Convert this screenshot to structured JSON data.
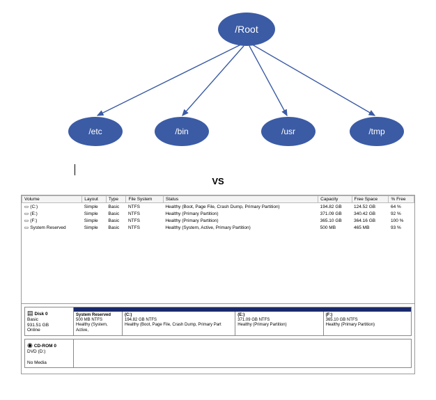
{
  "tree": {
    "root": "/Root",
    "children": [
      "/etc",
      "/bin",
      "/usr",
      "/tmp"
    ]
  },
  "vs_label": "VS",
  "disk_mgmt": {
    "columns": [
      "Volume",
      "Layout",
      "Type",
      "File System",
      "Status",
      "Capacity",
      "Free Space",
      "% Free"
    ],
    "volumes": [
      {
        "icon": "▭",
        "name": "(C:)",
        "layout": "Simple",
        "type": "Basic",
        "fs": "NTFS",
        "status": "Healthy (Boot, Page File, Crash Dump, Primary Partition)",
        "capacity": "194.82 GB",
        "free": "124.52 GB",
        "pct": "64 %"
      },
      {
        "icon": "▭",
        "name": "(E:)",
        "layout": "Simple",
        "type": "Basic",
        "fs": "NTFS",
        "status": "Healthy (Primary Partition)",
        "capacity": "371.09 GB",
        "free": "340.42 GB",
        "pct": "92 %"
      },
      {
        "icon": "▭",
        "name": "(F:)",
        "layout": "Simple",
        "type": "Basic",
        "fs": "NTFS",
        "status": "Healthy (Primary Partition)",
        "capacity": "365.10 GB",
        "free": "364.16 GB",
        "pct": "100 %"
      },
      {
        "icon": "▭",
        "name": "System Reserved",
        "layout": "Simple",
        "type": "Basic",
        "fs": "NTFS",
        "status": "Healthy (System, Active, Primary Partition)",
        "capacity": "500 MB",
        "free": "465 MB",
        "pct": "93 %"
      }
    ],
    "disks": [
      {
        "icon": "▤",
        "name": "Disk 0",
        "type": "Basic",
        "size": "931.51 GB",
        "status": "Online",
        "partitions": [
          {
            "title": "System Reserved",
            "line2": "500 MB NTFS",
            "line3": "Healthy (System, Active,",
            "flex": "0 0 70px"
          },
          {
            "title": "(C:)",
            "line2": "194.82 GB NTFS",
            "line3": "Healthy (Boot, Page File, Crash Dump, Primary Part",
            "flex": "1.3"
          },
          {
            "title": "(E:)",
            "line2": "371.09 GB NTFS",
            "line3": "Healthy (Primary Partition)",
            "flex": "1"
          },
          {
            "title": "(F:)",
            "line2": "365.10 GB NTFS",
            "line3": "Healthy (Primary Partition)",
            "flex": "1"
          }
        ]
      },
      {
        "icon": "◉",
        "name": "CD-ROM 0",
        "type": "DVD (D:)",
        "size": "",
        "status": "No Media",
        "partitions": []
      }
    ]
  }
}
